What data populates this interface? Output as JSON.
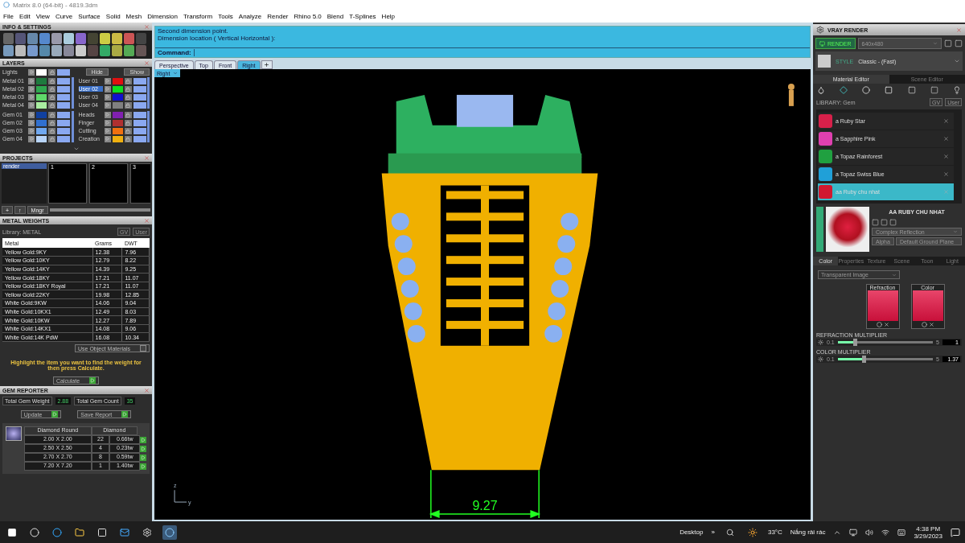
{
  "window": {
    "title": "Matrix 8.0 (64-bit) - 4819.3dm"
  },
  "menu": [
    "File",
    "Edit",
    "View",
    "Curve",
    "Surface",
    "Solid",
    "Mesh",
    "Dimension",
    "Transform",
    "Tools",
    "Analyze",
    "Render",
    "Rhino 5.0",
    "Blend",
    "T-Splines",
    "Help"
  ],
  "info_settings": {
    "title": "INFO & SETTINGS"
  },
  "layers": {
    "title": "LAYERS",
    "lights": {
      "name": "Lights",
      "color": "#ffffff"
    },
    "hide": "Hide",
    "show": "Show",
    "groups": [
      {
        "items": [
          {
            "name": "Metal 01",
            "color": "#1e7a3e",
            "selected": false
          },
          {
            "name": "Metal 02",
            "color": "#2fa84f",
            "selected": false
          },
          {
            "name": "Metal 03",
            "color": "#5fd86a",
            "selected": false
          },
          {
            "name": "Metal 04",
            "color": "#a8eca0",
            "selected": false
          }
        ]
      },
      {
        "items": [
          {
            "name": "User 01",
            "color": "#e01010",
            "selected": false
          },
          {
            "name": "User 02",
            "color": "#10e020",
            "selected": true
          },
          {
            "name": "User 03",
            "color": "#1010d0",
            "selected": false
          },
          {
            "name": "User 04",
            "color": "#808080",
            "selected": false
          }
        ]
      },
      {
        "items": [
          {
            "name": "Gem 01",
            "color": "#1040a0",
            "selected": false
          },
          {
            "name": "Gem 02",
            "color": "#3070d0",
            "selected": false
          },
          {
            "name": "Gem 03",
            "color": "#70a8f0",
            "selected": false
          },
          {
            "name": "Gem 04",
            "color": "#b8d4f8",
            "selected": false
          }
        ]
      },
      {
        "items": [
          {
            "name": "Heads",
            "color": "#8020b0",
            "selected": false
          },
          {
            "name": "Finger",
            "color": "#b03030",
            "selected": false
          },
          {
            "name": "Cutting",
            "color": "#f07010",
            "selected": false
          },
          {
            "name": "Creation",
            "color": "#f0b010",
            "selected": false
          }
        ]
      }
    ]
  },
  "projects": {
    "title": "PROJECTS",
    "items": [
      {
        "label": "render",
        "selected": true
      }
    ],
    "thumbnails": [
      "1",
      "2",
      "3"
    ],
    "buttons": [
      "+",
      "↑",
      "Mngr"
    ]
  },
  "metal_weights": {
    "title": "METAL WEIGHTS",
    "library": "Library: METAL",
    "toggles": [
      "GV",
      "User"
    ],
    "columns": [
      "Metal",
      "Grams",
      "DWT"
    ],
    "rows": [
      [
        "Yellow Gold:9KY",
        "12.38",
        "7.96"
      ],
      [
        "Yellow Gold:10KY",
        "12.79",
        "8.22"
      ],
      [
        "Yellow Gold:14KY",
        "14.39",
        "9.25"
      ],
      [
        "Yellow Gold:18KY",
        "17.21",
        "11.07"
      ],
      [
        "Yellow Gold:18KY Royal",
        "17.21",
        "11.07"
      ],
      [
        "Yellow Gold:22KY",
        "19.98",
        "12.85"
      ],
      [
        "White Gold:9KW",
        "14.06",
        "9.04"
      ],
      [
        "White Gold:10KX1",
        "12.49",
        "8.03"
      ],
      [
        "White Gold:10KW",
        "12.27",
        "7.89"
      ],
      [
        "White Gold:14KX1",
        "14.08",
        "9.06"
      ],
      [
        "White Gold:14K PdW",
        "16.08",
        "10.34"
      ]
    ],
    "use_object_materials": "Use Object Materials",
    "use_object_materials_checked": false,
    "hint": "Highlight the item you want to find the weight for then press Calculate.",
    "calculate": "Calculate"
  },
  "gem_reporter": {
    "title": "GEM REPORTER",
    "total_weight_label": "Total Gem Weight",
    "total_weight": "2.88",
    "total_count_label": "Total Gem Count",
    "total_count": "35",
    "update": "Update",
    "save_report": "Save Report",
    "columns": [
      "Diamond Round",
      "Diamond"
    ],
    "rows": [
      [
        "2.00 X 2.00",
        "22",
        "0.66tw"
      ],
      [
        "2.50 X 2.50",
        "4",
        "0.23tw"
      ],
      [
        "2.70 X 2.70",
        "8",
        "0.59tw"
      ],
      [
        "7.20 X 7.20",
        "1",
        "1.40tw"
      ]
    ]
  },
  "command": {
    "history": [
      "Second dimension point.",
      "Dimension location ( Vertical  Horizontal ):"
    ],
    "prompt": "Command:"
  },
  "viewport": {
    "tabs": [
      {
        "label": "Perspective",
        "selected": false
      },
      {
        "label": "Top",
        "selected": false
      },
      {
        "label": "Front",
        "selected": false
      },
      {
        "label": "Right",
        "selected": true
      }
    ],
    "view_label": "Right",
    "dimension": "9.27",
    "axis_labels": [
      "z",
      "y"
    ]
  },
  "vray": {
    "title": "VRAY RENDER",
    "render": "RENDER",
    "resolution": "640x480",
    "style_label": "STYLE",
    "style": "Classic - (Fast)",
    "editor_tabs": [
      {
        "label": "Material Editor",
        "selected": true
      },
      {
        "label": "Scene Editor",
        "selected": false
      }
    ],
    "library": "LIBRARY: Gem",
    "toggles": [
      "GV",
      "User"
    ],
    "materials": [
      {
        "name": "a Ruby Star",
        "color": "#d8204a",
        "selected": false
      },
      {
        "name": "a Sapphire Pink",
        "color": "#e040b0",
        "selected": false
      },
      {
        "name": "a Topaz Rainforest",
        "color": "#20a040",
        "selected": false
      },
      {
        "name": "a Topaz Swiss Blue",
        "color": "#20a0d8",
        "selected": false
      },
      {
        "name": "aa Ruby chu nhat",
        "color": "#d01830",
        "selected": true
      }
    ],
    "material_title": "AA RUBY CHU NHAT",
    "reflection": "Complex Reflection",
    "alpha": "Alpha",
    "ground": "Default Ground Plane",
    "property_tabs": [
      {
        "label": "Color",
        "selected": true
      },
      {
        "label": "Properties",
        "selected": false
      },
      {
        "label": "Texture",
        "selected": false
      },
      {
        "label": "Scene",
        "selected": false
      },
      {
        "label": "Toon",
        "selected": false
      },
      {
        "label": "Light",
        "selected": false
      }
    ],
    "image_mode": "Transparent Image",
    "swatches": [
      "Refraction",
      "Color"
    ],
    "sliders": [
      {
        "label": "REFRACTION MULTIPLIER",
        "min": "0.1",
        "max": "5",
        "value": "1",
        "level": 0.18
      },
      {
        "label": "COLOR MULTIPLIER",
        "min": "0.1",
        "max": "5",
        "value": "1.37",
        "level": 0.27
      }
    ]
  },
  "taskbar": {
    "desktop": "Desktop",
    "more": "»",
    "temperature": "33°C",
    "weather": "Nắng rải rác",
    "time": "4:38 PM",
    "date": "3/29/2023"
  }
}
